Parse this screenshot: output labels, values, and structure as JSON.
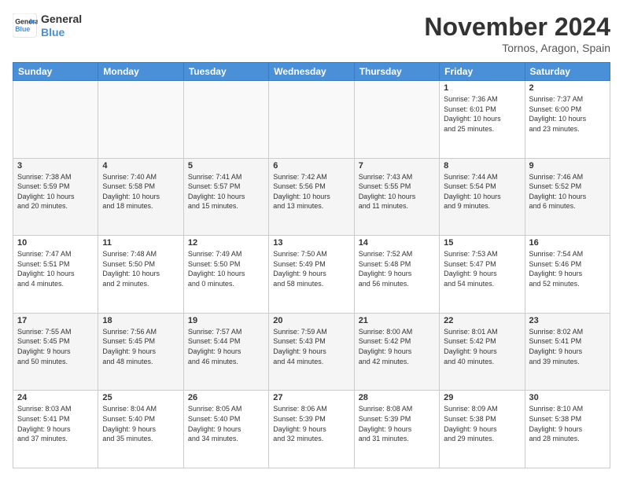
{
  "logo": {
    "line1": "General",
    "line2": "Blue"
  },
  "header": {
    "title": "November 2024",
    "location": "Tornos, Aragon, Spain"
  },
  "weekdays": [
    "Sunday",
    "Monday",
    "Tuesday",
    "Wednesday",
    "Thursday",
    "Friday",
    "Saturday"
  ],
  "weeks": [
    [
      {
        "day": "",
        "info": ""
      },
      {
        "day": "",
        "info": ""
      },
      {
        "day": "",
        "info": ""
      },
      {
        "day": "",
        "info": ""
      },
      {
        "day": "",
        "info": ""
      },
      {
        "day": "1",
        "info": "Sunrise: 7:36 AM\nSunset: 6:01 PM\nDaylight: 10 hours\nand 25 minutes."
      },
      {
        "day": "2",
        "info": "Sunrise: 7:37 AM\nSunset: 6:00 PM\nDaylight: 10 hours\nand 23 minutes."
      }
    ],
    [
      {
        "day": "3",
        "info": "Sunrise: 7:38 AM\nSunset: 5:59 PM\nDaylight: 10 hours\nand 20 minutes."
      },
      {
        "day": "4",
        "info": "Sunrise: 7:40 AM\nSunset: 5:58 PM\nDaylight: 10 hours\nand 18 minutes."
      },
      {
        "day": "5",
        "info": "Sunrise: 7:41 AM\nSunset: 5:57 PM\nDaylight: 10 hours\nand 15 minutes."
      },
      {
        "day": "6",
        "info": "Sunrise: 7:42 AM\nSunset: 5:56 PM\nDaylight: 10 hours\nand 13 minutes."
      },
      {
        "day": "7",
        "info": "Sunrise: 7:43 AM\nSunset: 5:55 PM\nDaylight: 10 hours\nand 11 minutes."
      },
      {
        "day": "8",
        "info": "Sunrise: 7:44 AM\nSunset: 5:54 PM\nDaylight: 10 hours\nand 9 minutes."
      },
      {
        "day": "9",
        "info": "Sunrise: 7:46 AM\nSunset: 5:52 PM\nDaylight: 10 hours\nand 6 minutes."
      }
    ],
    [
      {
        "day": "10",
        "info": "Sunrise: 7:47 AM\nSunset: 5:51 PM\nDaylight: 10 hours\nand 4 minutes."
      },
      {
        "day": "11",
        "info": "Sunrise: 7:48 AM\nSunset: 5:50 PM\nDaylight: 10 hours\nand 2 minutes."
      },
      {
        "day": "12",
        "info": "Sunrise: 7:49 AM\nSunset: 5:50 PM\nDaylight: 10 hours\nand 0 minutes."
      },
      {
        "day": "13",
        "info": "Sunrise: 7:50 AM\nSunset: 5:49 PM\nDaylight: 9 hours\nand 58 minutes."
      },
      {
        "day": "14",
        "info": "Sunrise: 7:52 AM\nSunset: 5:48 PM\nDaylight: 9 hours\nand 56 minutes."
      },
      {
        "day": "15",
        "info": "Sunrise: 7:53 AM\nSunset: 5:47 PM\nDaylight: 9 hours\nand 54 minutes."
      },
      {
        "day": "16",
        "info": "Sunrise: 7:54 AM\nSunset: 5:46 PM\nDaylight: 9 hours\nand 52 minutes."
      }
    ],
    [
      {
        "day": "17",
        "info": "Sunrise: 7:55 AM\nSunset: 5:45 PM\nDaylight: 9 hours\nand 50 minutes."
      },
      {
        "day": "18",
        "info": "Sunrise: 7:56 AM\nSunset: 5:45 PM\nDaylight: 9 hours\nand 48 minutes."
      },
      {
        "day": "19",
        "info": "Sunrise: 7:57 AM\nSunset: 5:44 PM\nDaylight: 9 hours\nand 46 minutes."
      },
      {
        "day": "20",
        "info": "Sunrise: 7:59 AM\nSunset: 5:43 PM\nDaylight: 9 hours\nand 44 minutes."
      },
      {
        "day": "21",
        "info": "Sunrise: 8:00 AM\nSunset: 5:42 PM\nDaylight: 9 hours\nand 42 minutes."
      },
      {
        "day": "22",
        "info": "Sunrise: 8:01 AM\nSunset: 5:42 PM\nDaylight: 9 hours\nand 40 minutes."
      },
      {
        "day": "23",
        "info": "Sunrise: 8:02 AM\nSunset: 5:41 PM\nDaylight: 9 hours\nand 39 minutes."
      }
    ],
    [
      {
        "day": "24",
        "info": "Sunrise: 8:03 AM\nSunset: 5:41 PM\nDaylight: 9 hours\nand 37 minutes."
      },
      {
        "day": "25",
        "info": "Sunrise: 8:04 AM\nSunset: 5:40 PM\nDaylight: 9 hours\nand 35 minutes."
      },
      {
        "day": "26",
        "info": "Sunrise: 8:05 AM\nSunset: 5:40 PM\nDaylight: 9 hours\nand 34 minutes."
      },
      {
        "day": "27",
        "info": "Sunrise: 8:06 AM\nSunset: 5:39 PM\nDaylight: 9 hours\nand 32 minutes."
      },
      {
        "day": "28",
        "info": "Sunrise: 8:08 AM\nSunset: 5:39 PM\nDaylight: 9 hours\nand 31 minutes."
      },
      {
        "day": "29",
        "info": "Sunrise: 8:09 AM\nSunset: 5:38 PM\nDaylight: 9 hours\nand 29 minutes."
      },
      {
        "day": "30",
        "info": "Sunrise: 8:10 AM\nSunset: 5:38 PM\nDaylight: 9 hours\nand 28 minutes."
      }
    ]
  ]
}
